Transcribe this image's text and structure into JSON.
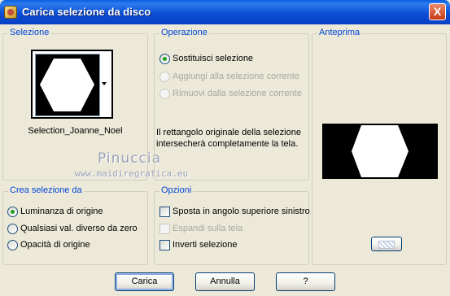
{
  "window": {
    "title": "Carica selezione da disco",
    "close_glyph": "X",
    "icon": "app-icon"
  },
  "selezione": {
    "legend": "Selezione",
    "preset_name": "Selection_Joanne_Noel",
    "dropdown_icon": "chevron-down-icon"
  },
  "watermark": {
    "line1": "Pinuccia",
    "line2": "www.maidiregrafica.eu"
  },
  "operazione": {
    "legend": "Operazione",
    "options": [
      {
        "label": "Sostituisci selezione",
        "checked": true,
        "enabled": true
      },
      {
        "label": "Aggiungi alla selezione corrente",
        "checked": false,
        "enabled": false
      },
      {
        "label": "Rimuovi dalla selezione corrente",
        "checked": false,
        "enabled": false
      }
    ],
    "note": "Il rettangolo originale della selezione intersecherà completamente la tela."
  },
  "anteprima": {
    "legend": "Anteprima",
    "zoom_button_icon": "zoom-icon"
  },
  "crea_selezione": {
    "legend": "Crea selezione da",
    "options": [
      {
        "label": "Luminanza di origine",
        "checked": true
      },
      {
        "label": "Qualsiasi val. diverso da zero",
        "checked": false
      },
      {
        "label": "Opacità di origine",
        "checked": false
      }
    ]
  },
  "opzioni": {
    "legend": "Opzioni",
    "checks": [
      {
        "label": "Sposta in angolo superiore sinistro",
        "checked": false,
        "enabled": true
      },
      {
        "label": "Espandi sulla tela",
        "checked": false,
        "enabled": false
      },
      {
        "label": "Inverti selezione",
        "checked": false,
        "enabled": true
      }
    ]
  },
  "buttons": {
    "carica": "Carica",
    "annulla": "Annulla",
    "help": "?"
  }
}
